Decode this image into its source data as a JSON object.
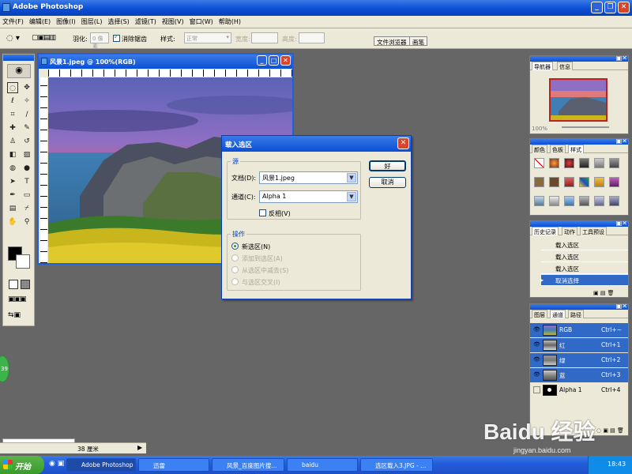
{
  "app": {
    "title": "Adobe Photoshop"
  },
  "menu": [
    "文件(F)",
    "编辑(E)",
    "图像(I)",
    "图层(L)",
    "选择(S)",
    "滤镜(T)",
    "视图(V)",
    "窗口(W)",
    "帮助(H)"
  ],
  "options": {
    "feather_label": "羽化:",
    "feather_value": "0 像素",
    "antialias_label": "消除锯齿",
    "style_label": "样式:",
    "style_value": "正常",
    "width_label": "宽度:",
    "height_label": "高度:",
    "file_browser": "文件浏览器",
    "brushes": "画笔"
  },
  "document": {
    "title": "风景1.jpeg @ 100%(RGB)"
  },
  "dialog": {
    "title": "载入选区",
    "source_group": "源",
    "doc_label": "文档(D):",
    "doc_value": "风景1.jpeg",
    "channel_label": "通道(C):",
    "channel_value": "Alpha 1",
    "invert_label": "反相(V)",
    "ok": "好",
    "cancel": "取消",
    "op_group": "操作",
    "op_new": "新选区(N)",
    "op_add": "添加到选区(A)",
    "op_sub": "从选区中减去(S)",
    "op_intersect": "与选区交叉(I)"
  },
  "navigator": {
    "tabs": [
      "导航器",
      "信息"
    ],
    "zoom": "100%"
  },
  "color": {
    "tabs": [
      "颜色",
      "色板",
      "样式"
    ]
  },
  "history": {
    "tabs": [
      "历史记录",
      "动作",
      "工具预设"
    ],
    "items": [
      "载入选区",
      "载入选区",
      "载入选区",
      "取消选择"
    ]
  },
  "channels": {
    "tabs": [
      "图层",
      "通道",
      "路径"
    ],
    "rows": [
      {
        "name": "RGB",
        "key": "Ctrl+~"
      },
      {
        "name": "红",
        "key": "Ctrl+1"
      },
      {
        "name": "绿",
        "key": "Ctrl+2"
      },
      {
        "name": "蓝",
        "key": "Ctrl+3"
      },
      {
        "name": "Alpha 1",
        "key": "Ctrl+4"
      }
    ]
  },
  "status": {
    "text": "38 厘米"
  },
  "ime": {
    "text": "中 ☽ °, 大 ☺"
  },
  "bubble": {
    "text": "39"
  },
  "taskbar": {
    "start": "开始",
    "items": [
      "Adobe Photoshop",
      "迅雷",
      "风景_百度图片搜...",
      "baidu",
      "选区载入3.JPG - ..."
    ],
    "time": "18:43"
  },
  "watermark": {
    "text": "Baidu 经验",
    "sub": "jingyan.baidu.com"
  },
  "colors": {
    "xp_blue": "#0a4fd6",
    "selection": "#3169c6",
    "xp_face": "#ece9d8",
    "workspace": "#666666"
  }
}
